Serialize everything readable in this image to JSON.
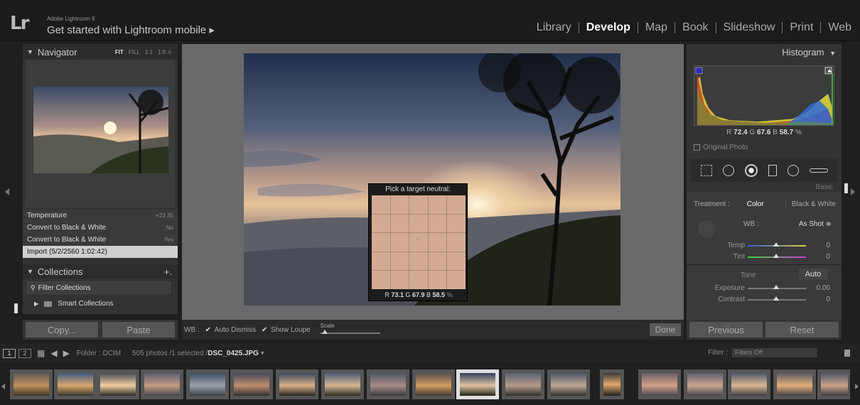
{
  "header": {
    "app_name": "Adobe Lightroom 6",
    "subtitle": "Get started with Lightroom mobile ▸",
    "logo": "Lr",
    "modules": [
      "Library",
      "Develop",
      "Map",
      "Book",
      "Slideshow",
      "Print",
      "Web"
    ],
    "active_module": "Develop"
  },
  "navigator": {
    "title": "Navigator",
    "zoom": [
      "FIT",
      "FILL",
      "1:1",
      "1:8 ≑"
    ]
  },
  "history": {
    "items": [
      {
        "label": "Temperature",
        "value": "+23  35"
      },
      {
        "label": "Convert to Black & White",
        "value": "No"
      },
      {
        "label": "Convert to Black & White",
        "value": "Yes"
      },
      {
        "label": "Import (5/2/2560 1:02:42)",
        "value": ""
      }
    ]
  },
  "collections": {
    "title": "Collections",
    "plus": "+.",
    "filter": "Filter Collections",
    "smart": "Smart Collections"
  },
  "left_buttons": {
    "copy": "Copy...",
    "paste": "Paste"
  },
  "picker": {
    "title": "Pick a target neutral:",
    "r": "73.1",
    "g": "67.9",
    "b": "58.5",
    "unit": "%"
  },
  "toolbar": {
    "wb": "WB :",
    "auto_dismiss": "Auto Dismiss",
    "show_loupe": "Show Loupe",
    "scale": "Scale",
    "done": "Done"
  },
  "histogram": {
    "title": "Histogram",
    "r": "72.4",
    "g": "67.6",
    "b": "58.7",
    "unit": "%",
    "original_photo": "Original Photo"
  },
  "basic": {
    "label": "Basic",
    "treatment": "Treatment :",
    "color": "Color",
    "bw": "Black & White",
    "wb": "WB :",
    "wb_value": "As Shot ≑",
    "temp_label": "Temp",
    "temp_value": "0",
    "tint_label": "Tint",
    "tint_value": "0",
    "tone": "Tone",
    "auto": "Auto",
    "exposure_label": "Exposure",
    "exposure_value": "0.00",
    "contrast_label": "Contrast",
    "contrast_value": "0"
  },
  "right_buttons": {
    "previous": "Previous",
    "reset": "Reset"
  },
  "filmbar": {
    "page1": "1",
    "page2": "2",
    "folder": "Folder : DCIM",
    "count": "505 photos /1 selected /",
    "filename": "DSC_0425.JPG",
    "filter_label": "Filter :",
    "filter_value": "Filters Off"
  },
  "colors": {
    "accent": "#ffffff",
    "panel": "#333333",
    "picker_cell": "#d3ab92"
  }
}
